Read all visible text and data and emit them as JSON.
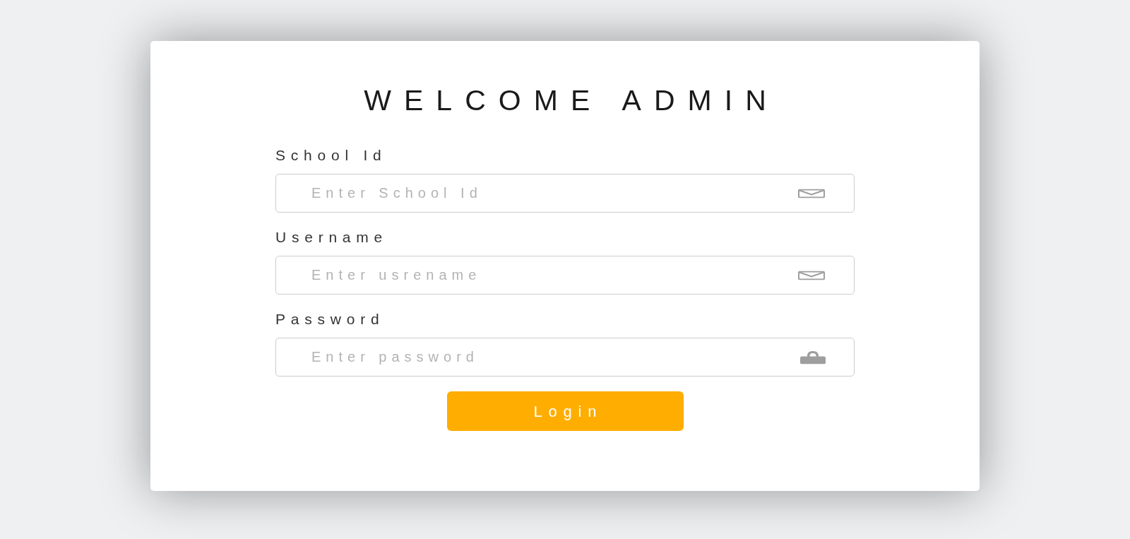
{
  "title": "WELCOME ADMIN",
  "fields": [
    {
      "kind": "text",
      "label": "School Id",
      "placeholder": "Enter School Id"
    },
    {
      "kind": "text",
      "label": "Username",
      "placeholder": "Enter usrename"
    },
    {
      "kind": "password",
      "label": "Password",
      "placeholder": "Enter password"
    }
  ],
  "login_button": {
    "label": "Login"
  }
}
